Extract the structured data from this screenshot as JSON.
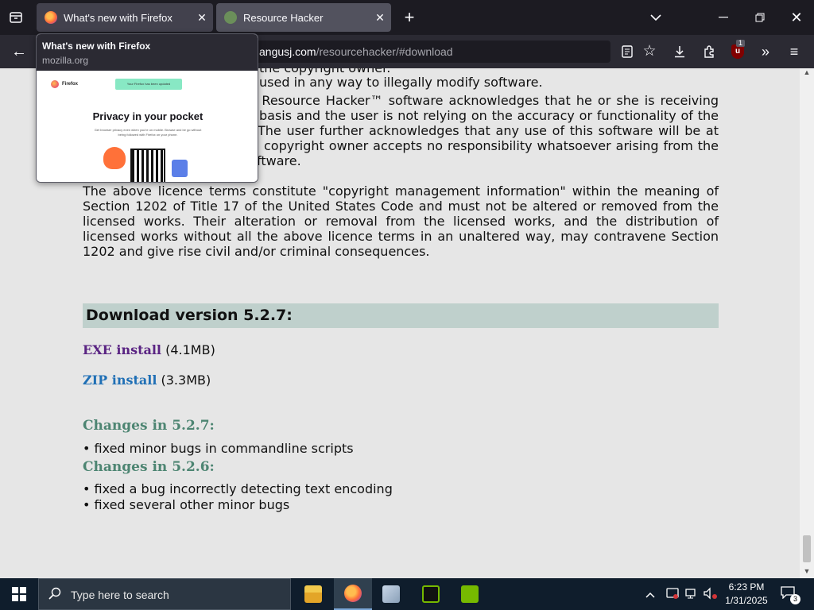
{
  "browser": {
    "tabs": [
      {
        "title": "What's new with Firefox",
        "active": false
      },
      {
        "title": "Resource Hacker",
        "active": true
      }
    ],
    "url_host": "angusj.com",
    "url_path": "/resourcehacker/#download",
    "ublock_count": "1",
    "icons": {
      "tab_list": "tab-list-icon",
      "new_tab": "plus-icon",
      "list_all_tabs": "chevron-down-icon",
      "minimize": "minimize-icon",
      "maximize": "restore-icon",
      "close": "close-icon",
      "back": "back-arrow-icon",
      "reader": "reader-view-icon",
      "bookmark": "star-icon",
      "downloads": "download-icon",
      "extensions": "puzzle-icon",
      "ublock": "ublock-icon",
      "overflow": "double-chevron-icon",
      "menu": "hamburger-icon"
    }
  },
  "tab_preview": {
    "title": "What's new with Firefox",
    "domain": "mozilla.org",
    "thumb_brand": "Firefox",
    "thumb_banner": "Your Firefox has been updated",
    "thumb_heading": "Privacy in your pocket",
    "thumb_sub": "Get browser privacy even when you're on mobile. Browse and be go without being followed with Firefox on your phone."
  },
  "page": {
    "top_lines": [
      "the copyright owner.",
      "used in any way to illegally modify software."
    ],
    "justified_lines": [
      "s Resource Hacker™ software acknowledges that he or she is receiving",
      "basis and the user is not relying on the accuracy or functionality of the",
      "The user further acknowledges that any use of this software will be at",
      "copyright owner accepts no responsibility whatsoever arising from the"
    ],
    "fragment_line": "ftware.",
    "licence_lines": [
      "The above licence terms constitute \"copyright management information\" within the meaning of",
      "Section 1202 of Title 17 of the United States Code and must not be altered or removed from the",
      "licensed works. Their alteration or removal from the licensed works, and the distribution of",
      "licensed works without all the above licence terms in an unaltered way, may contravene Section",
      "1202 and give rise civil and/or criminal consequences."
    ],
    "download_heading": "Download version 5.2.7:",
    "downloads": [
      {
        "label": "EXE install",
        "size": "(4.1MB)"
      },
      {
        "label": "ZIP install",
        "size": "(3.3MB)"
      }
    ],
    "changes": [
      {
        "heading": "Changes in 5.2.7:",
        "items": [
          "• fixed minor bugs in commandline scripts"
        ]
      },
      {
        "heading": "Changes in 5.2.6:",
        "items": [
          "• fixed a bug incorrectly detecting text encoding",
          "• fixed several other minor bugs"
        ]
      }
    ]
  },
  "taskbar": {
    "search_placeholder": "Type here to search",
    "apps": [
      "file-explorer",
      "firefox",
      "control-panel",
      "nvidia-app",
      "nvidia-geforce"
    ],
    "time": "6:23 PM",
    "date": "1/31/2025",
    "notification_count": "3"
  }
}
